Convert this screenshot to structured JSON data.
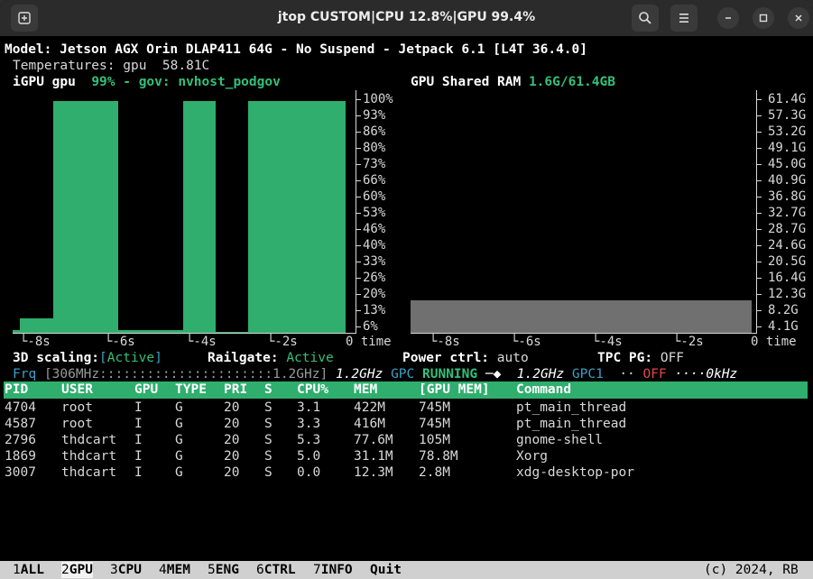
{
  "window": {
    "title": "jtop CUSTOM|CPU 12.8%|GPU 99.4%"
  },
  "info": {
    "model": "Model: Jetson AGX Orin DLAP411 64G - No Suspend - Jetpack 6.1 [L4T 36.4.0]",
    "temps_label": "Temperatures:",
    "temps_name": "gpu",
    "temps_value": "58.81C"
  },
  "gpu_panel": {
    "title": "iGPU gpu",
    "status": "99% - gov: nvhost_podgov",
    "y_ticks": [
      "100%",
      "93%",
      "86%",
      "80%",
      "73%",
      "66%",
      "60%",
      "53%",
      "46%",
      "40%",
      "33%",
      "26%",
      "20%",
      "13%",
      "6%"
    ],
    "x_ticks": [
      "-8s",
      "-6s",
      "-4s",
      "-2s",
      "0 time"
    ]
  },
  "ram_panel": {
    "title": "GPU Shared RAM",
    "value": "1.6G/61.4GB",
    "y_ticks": [
      "61.4G",
      "57.3G",
      "53.2G",
      "49.1G",
      "45.0G",
      "40.9G",
      "36.8G",
      "32.7G",
      "28.7G",
      "24.6G",
      "20.5G",
      "16.4G",
      "12.3G",
      "8.2G",
      "4.1G"
    ],
    "x_ticks": [
      "-8s",
      "-6s",
      "-4s",
      "-2s",
      "0 time"
    ]
  },
  "chart_data": [
    {
      "type": "bar",
      "x": [
        "-9.6s",
        "-9.2s",
        "-8.8s",
        "-8.0s",
        "-7.0s",
        "-6.0s",
        "-5.0s",
        "-4.0s",
        "-3.0s",
        "-2.0s",
        "-1.0s",
        "0s"
      ],
      "values": [
        1,
        6,
        6,
        99,
        99,
        0,
        1,
        99,
        0,
        99,
        99,
        99
      ],
      "ylim": [
        0,
        100
      ]
    },
    {
      "type": "area",
      "values_gb": [
        1.6,
        1.6,
        1.6,
        1.6,
        1.6
      ],
      "ylim": [
        0,
        61.4
      ]
    }
  ],
  "controls": {
    "scaling_label": "3D scaling:",
    "scaling_open": "[",
    "scaling_value": "Active",
    "scaling_close": "]",
    "railgate_label": "Railgate:",
    "railgate_value": "Active",
    "power_label": "Power ctrl:",
    "power_value": "auto",
    "tpc_label": "TPC PG:",
    "tpc_value": "OFF"
  },
  "freq": {
    "label": "Frq",
    "bar_text": "[306MHz::::::::::::::::::::::1.2GHz]",
    "cur": "1.2GHz",
    "gpc_label": "GPC",
    "gpc_state": "RUNNING",
    "gpc_freq": "1.2GHz",
    "gpc1_label": "GPC1",
    "gpc1_dots": "··",
    "gpc1_state": "OFF",
    "gpc1_freq": "····0kHz"
  },
  "table": {
    "headers": [
      "PID",
      "USER",
      "GPU",
      "TYPE",
      "PRI",
      "S",
      "CPU%",
      "MEM",
      "[GPU MEM]",
      "Command"
    ],
    "rows": [
      [
        "4704",
        "root",
        "I",
        "G",
        "20",
        "S",
        "3.1",
        "422M",
        "745M",
        "pt_main_thread"
      ],
      [
        "4587",
        "root",
        "I",
        "G",
        "20",
        "S",
        "3.3",
        "416M",
        "745M",
        "pt_main_thread"
      ],
      [
        "2796",
        "thdcart",
        "I",
        "G",
        "20",
        "S",
        "5.3",
        "77.6M",
        "105M",
        "gnome-shell"
      ],
      [
        "1869",
        "thdcart",
        "I",
        "G",
        "20",
        "S",
        "5.0",
        "31.1M",
        "78.8M",
        "Xorg"
      ],
      [
        "3007",
        "thdcart",
        "I",
        "G",
        "20",
        "S",
        "0.0",
        "12.3M",
        "2.8M",
        "xdg-desktop-por"
      ]
    ]
  },
  "footer": {
    "tabs": [
      {
        "num": "1",
        "label": "ALL"
      },
      {
        "num": "2",
        "label": "GPU"
      },
      {
        "num": "3",
        "label": "CPU"
      },
      {
        "num": "4",
        "label": "MEM"
      },
      {
        "num": "5",
        "label": "ENG"
      },
      {
        "num": "6",
        "label": "CTRL"
      },
      {
        "num": "7",
        "label": "INFO"
      }
    ],
    "quit": "Quit",
    "copyright": "(c) 2024, RB"
  },
  "colors": {
    "accent": "#2fae6e",
    "cyan": "#3aa0c8",
    "off_red": "#e04848",
    "ram_fill": "#707070"
  }
}
